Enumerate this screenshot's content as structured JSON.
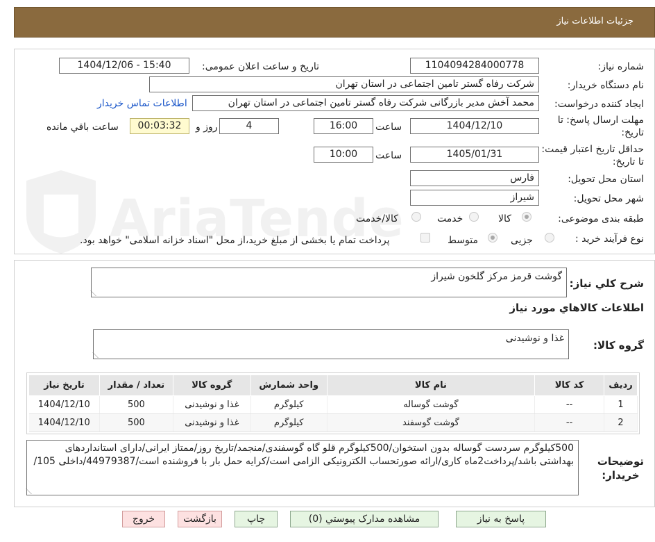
{
  "header": {
    "title": "جزئیات اطلاعات نیاز"
  },
  "fields": {
    "need_number_label": "شماره نیاز:",
    "need_number": "1104094284000778",
    "announce_label": "تاریخ و ساعت اعلان عمومی:",
    "announce_value": "1404/12/06 - 15:40",
    "buyer_org_label": "نام دستگاه خریدار:",
    "buyer_org": "شرکت رفاه گستر تامین اجتماعی در استان تهران",
    "requester_label": "ایجاد کننده درخواست:",
    "requester": "محمد آخش مدیر بازرگانی شرکت رفاه گستر تامین اجتماعی در استان تهران",
    "contact_link": "اطلاعات تماس خریدار",
    "deadline_label": "مهلت ارسال پاسخ: تا تاریخ:",
    "deadline_date": "1404/12/10",
    "time_label": "ساعت",
    "deadline_time": "16:00",
    "days_value": "4",
    "days_label": "روز و",
    "countdown": "00:03:32",
    "remaining_label": "ساعت باقي مانده",
    "price_validity_label": "حداقل تاریخ اعتبار قیمت: تا تاریخ:",
    "price_validity_date": "1405/01/31",
    "price_validity_time": "10:00",
    "province_label": "استان محل تحویل:",
    "province": "فارس",
    "city_label": "شهر محل تحویل:",
    "city": "شیراز",
    "category_label": "طبقه بندی موضوعی:",
    "category_options": [
      "کالا",
      "خدمت",
      "کالا/خدمت"
    ],
    "process_label": "نوع فرآیند خرید :",
    "process_options": [
      "جزیی",
      "متوسط"
    ],
    "payment_note": "پرداخت تمام یا بخشی از مبلغ خرید،از محل \"اسناد خزانه اسلامی\" خواهد بود."
  },
  "general": {
    "summary_label": "شرح کلي نیاز:",
    "summary": "گوشت قرمز مرکز گلخون شیراز",
    "goods_info_title": "اطلاعات کالاهاي مورد نیاز",
    "goods_group_label": "گروه کالا:",
    "goods_group": "غذا و نوشیدنی"
  },
  "table": {
    "headers": [
      "ردیف",
      "کد کالا",
      "نام کالا",
      "واحد شمارش",
      "گروه کالا",
      "تعداد / مقدار",
      "تاریخ نیاز"
    ],
    "rows": [
      [
        "1",
        "--",
        "گوشت گوساله",
        "کیلوگرم",
        "غذا و نوشیدنی",
        "500",
        "1404/12/10"
      ],
      [
        "2",
        "--",
        "گوشت گوسفند",
        "کیلوگرم",
        "غذا و نوشیدنی",
        "500",
        "1404/12/10"
      ]
    ]
  },
  "buyer_notes": {
    "label_line1": "توضیحات",
    "label_line2": "خریدار:",
    "text": "500کیلوگرم سردست گوساله بدون استخوان/500کیلوگرم قلو گاه گوسفندی/منجمد/تاریخ روز/ممتاز ایرانی/دارای استانداردهای بهداشتی باشد/پرداخت2ماه کاری/ارائه صورتحساب الکترونیکی الزامی است/کرایه حمل بار با فروشنده است/44979387/داخلی 105/"
  },
  "buttons": {
    "reply": "پاسخ به نیاز",
    "attachments": "مشاهده مدارک پیوستي (0)",
    "print": "چاپ",
    "back": "بازگشت",
    "exit": "خروج"
  },
  "watermark": {
    "text": "AriaTender.neT"
  }
}
